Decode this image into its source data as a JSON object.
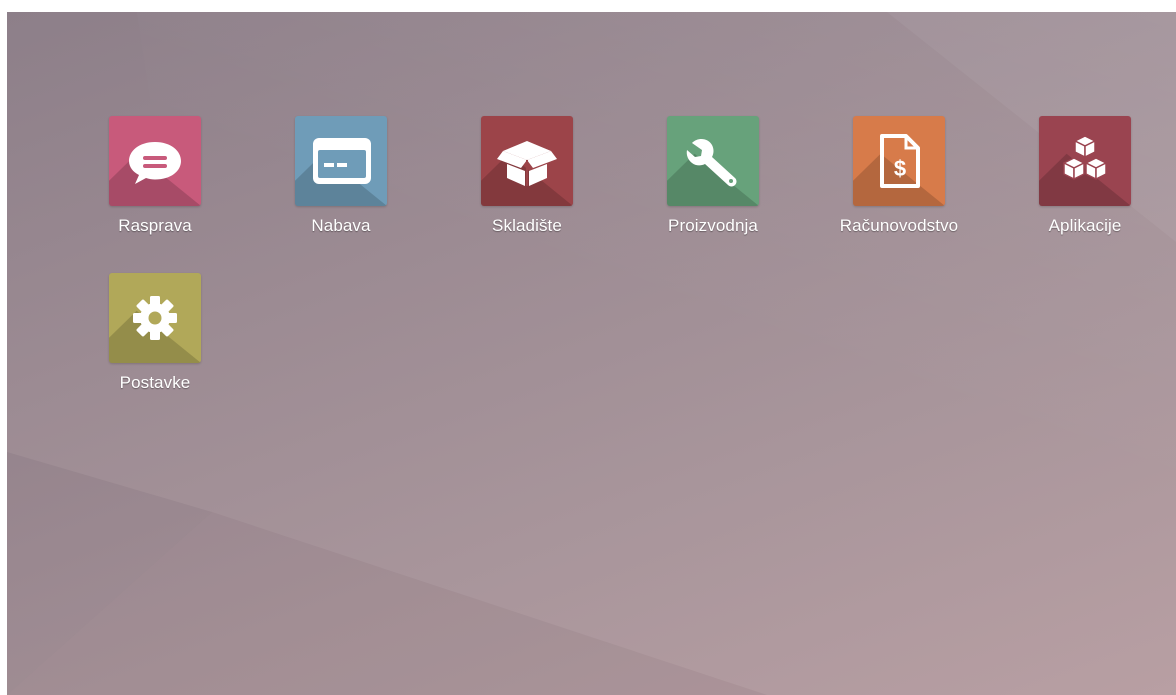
{
  "apps": [
    {
      "label": "Rasprava",
      "icon": "chat-bubble-icon",
      "color": "#c85a7b"
    },
    {
      "label": "Nabava",
      "icon": "credit-card-icon",
      "color": "#6f9cb8"
    },
    {
      "label": "Skladište",
      "icon": "open-box-icon",
      "color": "#9c4449"
    },
    {
      "label": "Proizvodnja",
      "icon": "wrench-icon",
      "color": "#67a27b"
    },
    {
      "label": "Računovodstvo",
      "icon": "invoice-dollar-icon",
      "color": "#d77b4a"
    },
    {
      "label": "Aplikacije",
      "icon": "cubes-icon",
      "color": "#9a4450"
    },
    {
      "label": "Postavke",
      "icon": "gear-icon",
      "color": "#b1a859"
    }
  ]
}
